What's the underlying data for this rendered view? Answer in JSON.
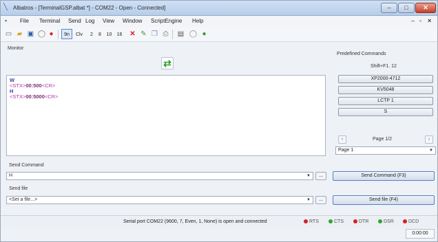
{
  "window": {
    "title": "Albatros - [TerminalGSP.albat *] - COM22 - Open - Connected]"
  },
  "menu": [
    "File",
    "Terminal",
    "Send",
    "Log",
    "View",
    "Window",
    "ScriptEngine",
    "Help"
  ],
  "toolbar": {
    "text_buttons": [
      "9n",
      "Clv",
      "2",
      "8",
      "10",
      "16"
    ]
  },
  "monitor": {
    "label": "Monitor",
    "lines": [
      {
        "kind": "rx",
        "text": "W"
      },
      {
        "kind": "tx_pre",
        "text": "<STX>",
        "bold": "00:500",
        "post": "<CR>"
      },
      {
        "kind": "rx",
        "text": "H"
      },
      {
        "kind": "tx_pre",
        "text": "<STX>",
        "bold": "00:5000",
        "post": "<CR>"
      }
    ]
  },
  "predefined": {
    "label": "Predefined Commands",
    "hint": "Shift+F1. 12",
    "buttons": [
      "XP2000-4712",
      "KV5048",
      "LCTP 1",
      "S"
    ],
    "page_label": "Page 1/2",
    "page_select": "Page 1"
  },
  "send_command": {
    "label": "Send Command",
    "value": "H",
    "ellipsis": "...",
    "button": "Send Command (F3)"
  },
  "send_file": {
    "label": "Send file",
    "value": "<Set a file...>",
    "ellipsis": "...",
    "button": "Send file (F4)"
  },
  "status": {
    "text": "Serial port COM22 (9600, 7, Even, 1, None) is open and connected",
    "leds": [
      {
        "name": "RTS",
        "color": "#d62020"
      },
      {
        "name": "CTS",
        "color": "#2fa52f"
      },
      {
        "name": "DTR",
        "color": "#d62020"
      },
      {
        "name": "DSR",
        "color": "#2fa52f"
      },
      {
        "name": "DCD",
        "color": "#d62020"
      }
    ],
    "timer": "0:00:00"
  }
}
